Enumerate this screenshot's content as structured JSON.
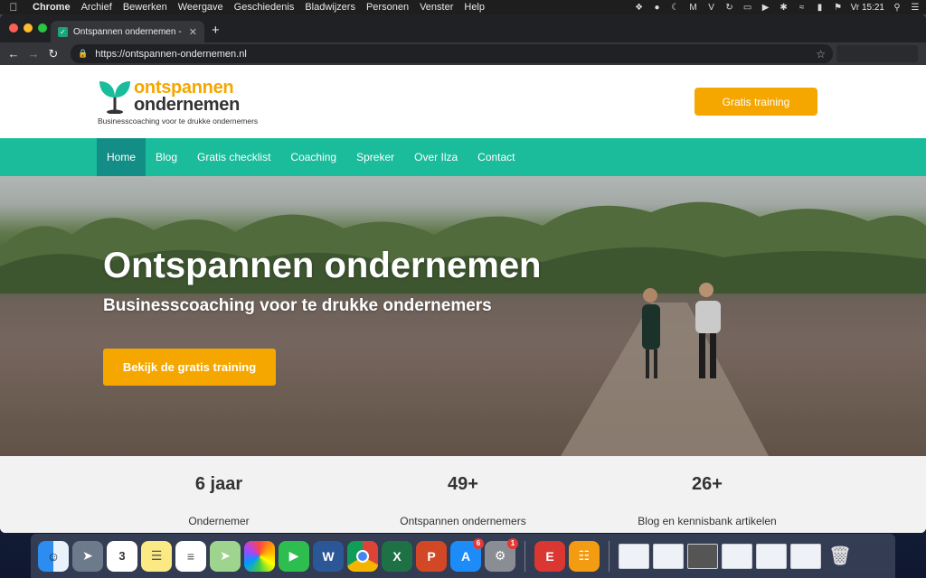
{
  "menubar": {
    "app": "Chrome",
    "items": [
      "Archief",
      "Bewerken",
      "Weergave",
      "Geschiedenis",
      "Bladwijzers",
      "Personen",
      "Venster",
      "Help"
    ],
    "clock": "Vr 15:21"
  },
  "browser": {
    "tab_title": "Ontspannen ondernemen - Bus",
    "url": "https://ontspannen-ondernemen.nl"
  },
  "site": {
    "logo_line1": "ontspannen",
    "logo_line2": "ondernemen",
    "logo_tagline": "Businesscoaching voor te drukke ondernemers",
    "header_cta": "Gratis training",
    "nav": [
      "Home",
      "Blog",
      "Gratis checklist",
      "Coaching",
      "Spreker",
      "Over Ilza",
      "Contact"
    ],
    "hero_title": "Ontspannen ondernemen",
    "hero_subtitle": "Businesscoaching voor te drukke ondernemers",
    "hero_button": "Bekijk de gratis training",
    "stats": [
      {
        "number": "6 jaar",
        "label": "Ondernemer"
      },
      {
        "number": "49+",
        "label": "Ontspannen ondernemers"
      },
      {
        "number": "26+",
        "label": "Blog en kennisbank artikelen"
      }
    ]
  },
  "colors": {
    "brand_teal": "#1abc9c",
    "nav_active": "#138e86",
    "brand_orange": "#f5a700"
  },
  "dock": {
    "badges": {
      "app_store": "6",
      "system_prefs": "1"
    },
    "calendar_day": "3"
  }
}
